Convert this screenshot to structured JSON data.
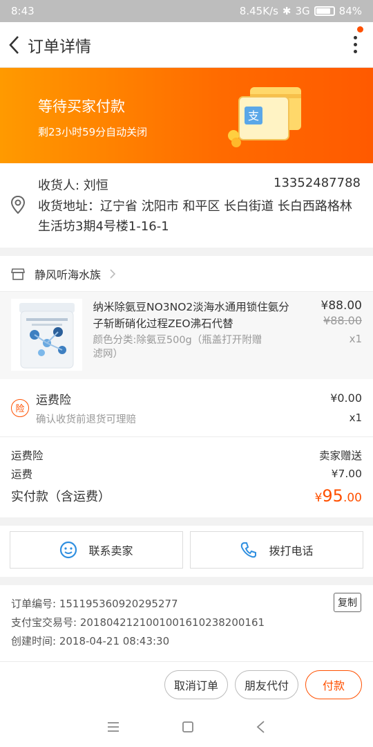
{
  "status_bar": {
    "time": "8:43",
    "speed": "8.45K/s",
    "network": "3G",
    "battery": "84%"
  },
  "nav": {
    "title": "订单详情"
  },
  "banner": {
    "status": "等待买家付款",
    "countdown": "剩23小时59分自动关闭"
  },
  "address": {
    "receiver": "收货人: 刘恒",
    "phone": "13352487788",
    "detail": "收货地址：辽宁省 沈阳市 和平区 长白街道 长白西路格林生活坊3期4号楼1-16-1"
  },
  "shop": {
    "name": "静风听海水族"
  },
  "product": {
    "title": "纳米除氨豆NO3NO2淡海水通用锁住氨分子斩断硝化过程ZEO沸石代替",
    "sku": "颜色分类:除氨豆500g（瓶盖打开附赠滤网）",
    "price": "¥88.00",
    "original_price": "¥88.00",
    "quantity": "x1"
  },
  "insurance": {
    "icon_text": "险",
    "title": "运费险",
    "desc": "确认收货前退货可理赔",
    "price": "¥0.00",
    "quantity": "x1"
  },
  "fees": {
    "insurance_label": "运费险",
    "insurance_value": "卖家赠送",
    "shipping_label": "运费",
    "shipping_value": "¥7.00",
    "total_label": "实付款（含运费）",
    "total_currency": "¥",
    "total_integer": "95",
    "total_decimal": ".00"
  },
  "contact": {
    "seller_label": "联系卖家",
    "call_label": "拨打电话"
  },
  "order_info": {
    "order_no": "订单编号: 151195360920295277",
    "alipay_no": "支付宝交易号: 2018042121001001610238200161",
    "created": "创建时间: 2018-04-21 08:43:30",
    "copy_label": "复制"
  },
  "actions": {
    "cancel_label": "取消订单",
    "friend_pay_label": "朋友代付",
    "pay_label": "付款"
  },
  "colors": {
    "accent": "#ff5000",
    "banner_start": "#ff9a00",
    "banner_end": "#ff5a00",
    "phone_blue": "#2f8fe0"
  },
  "icons": [
    "back-icon",
    "more-icon",
    "location-icon",
    "shop-icon",
    "chevron-right-icon",
    "chat-icon",
    "phone-icon",
    "menu-icon",
    "home-square-icon",
    "back-triangle-icon"
  ]
}
